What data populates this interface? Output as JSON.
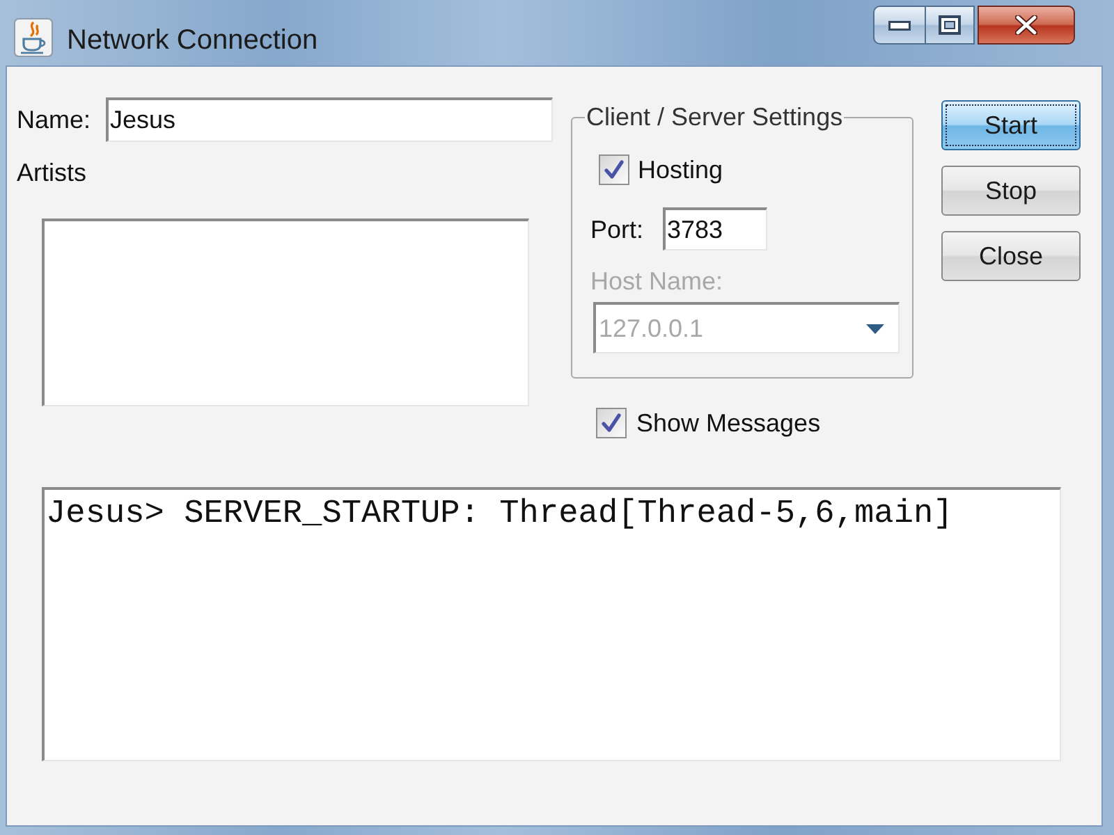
{
  "window": {
    "title": "Network Connection"
  },
  "name": {
    "label": "Name:",
    "value": "Jesus"
  },
  "artists": {
    "label": "Artists"
  },
  "client_server_settings": {
    "title": "Client / Server Settings",
    "hosting": {
      "label": "Hosting",
      "checked": true
    },
    "port": {
      "label": "Port:",
      "value": "3783"
    },
    "host_name": {
      "label": "Host Name:",
      "value": "127.0.0.1",
      "disabled": true
    }
  },
  "show_messages": {
    "label": "Show Messages",
    "checked": true
  },
  "buttons": [
    {
      "label": "Start",
      "focused": true
    },
    {
      "label": "Stop",
      "focused": false
    },
    {
      "label": "Close",
      "focused": false
    }
  ],
  "messages": [
    "Jesus> SERVER_STARTUP: Thread[Thread-5,6,main]"
  ]
}
